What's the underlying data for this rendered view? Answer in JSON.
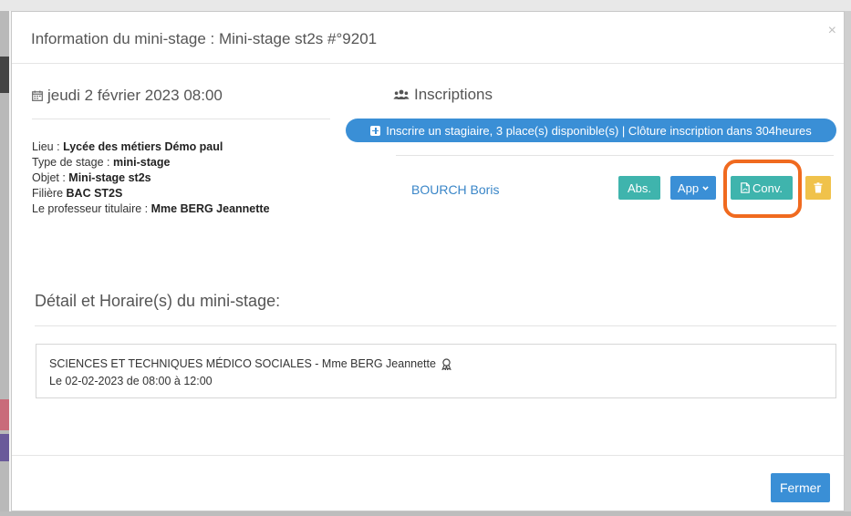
{
  "modal": {
    "title": "Information du mini-stage : Mini-stage st2s #°9201",
    "close_glyph": "×"
  },
  "event": {
    "date": "jeudi 2 février 2023 08:00",
    "fields": [
      {
        "label": "Lieu : ",
        "value": "Lycée des métiers Démo paul"
      },
      {
        "label": "Type de stage : ",
        "value": "mini-stage"
      },
      {
        "label": "Objet : ",
        "value": "Mini-stage st2s"
      },
      {
        "label": "Filière ",
        "value": "BAC ST2S"
      },
      {
        "label": "Le professeur titulaire : ",
        "value": "Mme BERG Jeannette"
      }
    ]
  },
  "inscriptions": {
    "title": "Inscriptions",
    "register_button": "Inscrire un stagiaire, 3 place(s) disponible(s) | Clôture inscription dans 304heures",
    "student": "BOURCH Boris",
    "btn_abs": "Abs.",
    "btn_app": "App",
    "btn_conv": "Conv."
  },
  "details": {
    "title": "Détail et Horaire(s) du mini-stage:",
    "line1": "SCIENCES ET TECHNIQUES MÉDICO SOCIALES - Mme BERG Jeannette",
    "line2": "Le 02-02-2023 de 08:00 à 12:00"
  },
  "footer": {
    "close_button": "Fermer"
  },
  "colors": {
    "primary": "#3a8fd6",
    "teal": "#3fb4ad",
    "warning": "#f0c24b",
    "highlight": "#f06a1f"
  }
}
